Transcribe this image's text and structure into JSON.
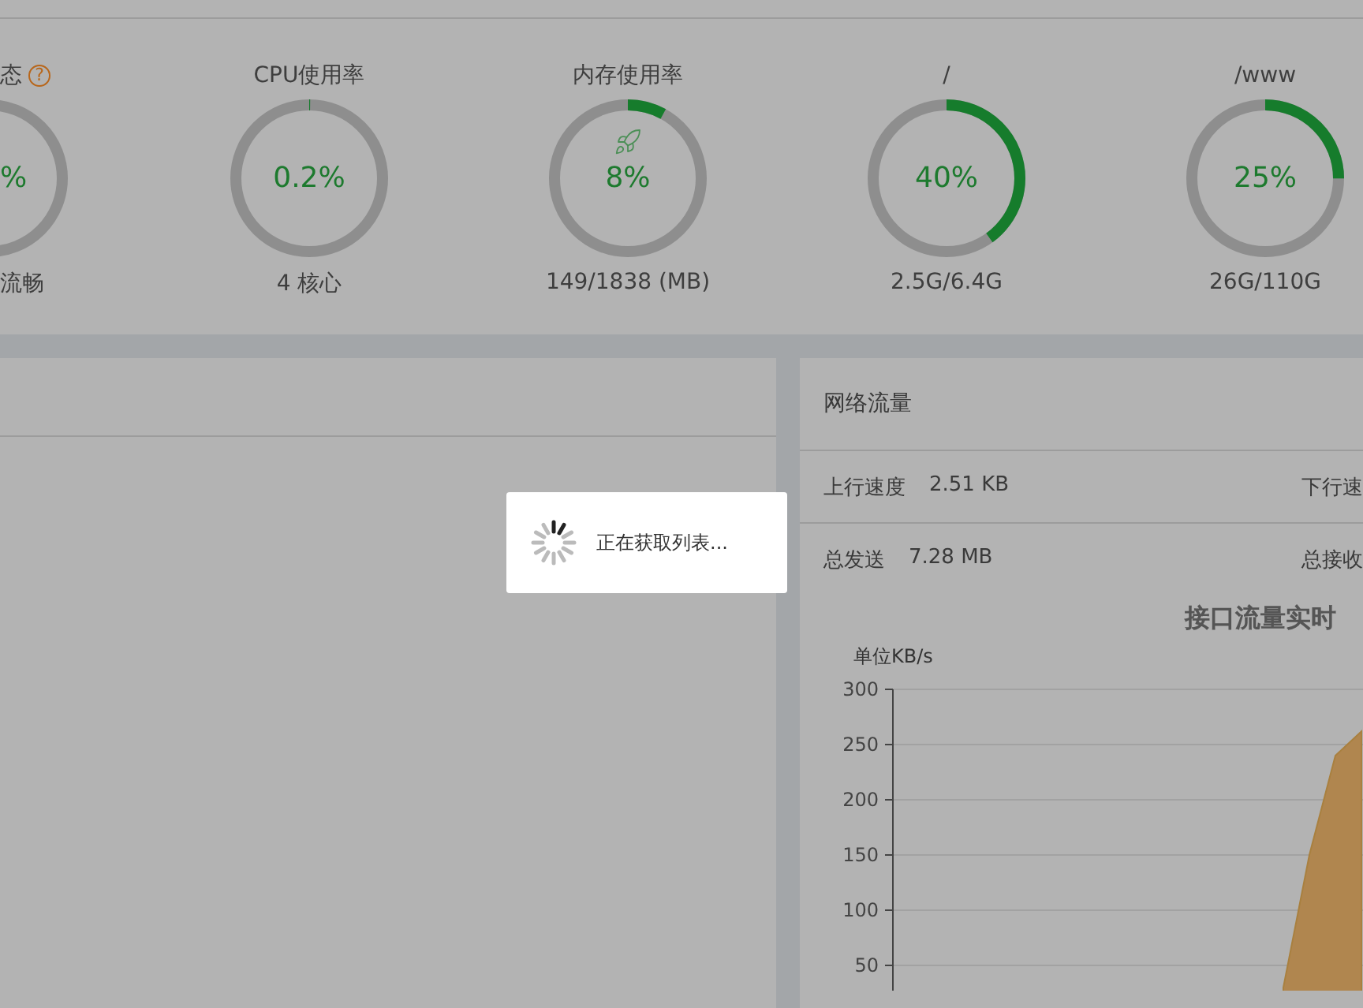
{
  "gauges": [
    {
      "kind": "load",
      "title": "态",
      "help": "?",
      "value": "%",
      "detail": "流畅",
      "level": 0
    },
    {
      "kind": "cpu",
      "title": "CPU使用率",
      "value": "0.2%",
      "detail": "4 核心",
      "level": 0.002
    },
    {
      "kind": "memory",
      "title": "内存使用率",
      "value": "8%",
      "detail": "149/1838 (MB)",
      "level": 0.08
    },
    {
      "kind": "disk",
      "title": "/",
      "value": "40%",
      "detail": "2.5G/6.4G",
      "level": 0.4
    },
    {
      "kind": "disk",
      "title": "/www",
      "value": "25%",
      "detail": "26G/110G",
      "level": 0.25
    }
  ],
  "network": {
    "title": "网络流量",
    "stats": [
      [
        {
          "label": "上行速度",
          "value": "2.51 KB"
        },
        {
          "label": "下行速"
        }
      ],
      [
        {
          "label": "总发送",
          "value": "7.28 MB"
        },
        {
          "label": "总接收"
        }
      ]
    ],
    "chart_data": {
      "type": "area",
      "title": "接口流量实时",
      "ylabel": "单位KB/s",
      "ylim": [
        0,
        300
      ],
      "yticks": [
        50,
        100,
        150,
        200,
        250,
        300
      ],
      "grid": true,
      "series": [
        {
          "color": "#b0864f",
          "values": [
            null,
            null,
            null,
            null,
            null,
            null,
            null,
            null,
            null,
            null,
            null,
            null,
            null,
            null,
            null,
            30,
            150,
            240,
            262
          ]
        }
      ]
    }
  },
  "loading": {
    "text": "正在获取列表..."
  }
}
